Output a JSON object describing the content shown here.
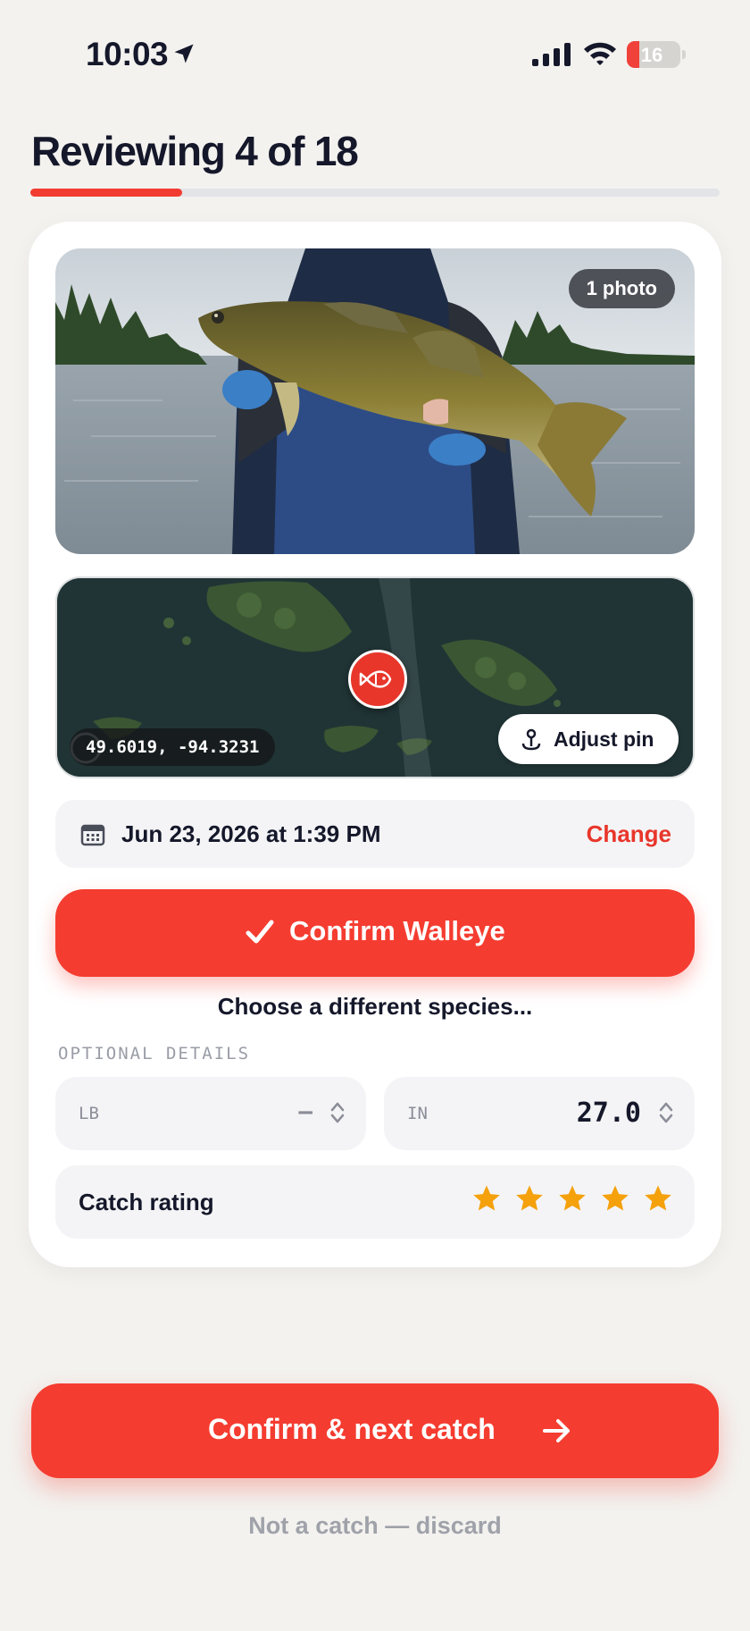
{
  "status_bar": {
    "time": "10:03",
    "battery": "16"
  },
  "review": {
    "title": "Reviewing 4 of 18",
    "progress": 0.22
  },
  "photo": {
    "badge": "1 photo"
  },
  "map": {
    "coordinates": "49.6019, -94.3231",
    "adjust_pin_label": "Adjust pin"
  },
  "date": {
    "text": "Jun 23, 2026 at 1:39 PM",
    "change_label": "Change"
  },
  "species": {
    "confirm_label": "Confirm Walleye",
    "choose_label": "Choose a different species..."
  },
  "optional": {
    "section_label": "OPTIONAL DETAILS",
    "weight": {
      "unit": "LB",
      "value": "—"
    },
    "length": {
      "unit": "IN",
      "value": "27.0"
    },
    "rating_label": "Catch rating",
    "rating": 5,
    "rating_max": 5,
    "star_color": "#f5a10c"
  },
  "footer": {
    "next_label": "Confirm & next catch",
    "discard_label": "Not a catch — discard"
  },
  "colors": {
    "accent": "#f53c30",
    "background": "#f3f2ef"
  }
}
